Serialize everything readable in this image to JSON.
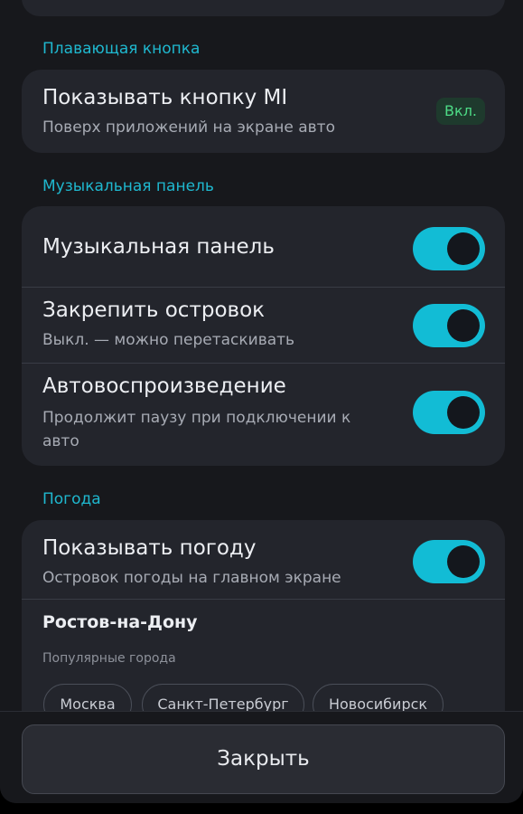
{
  "floating": {
    "section_title": "Плавающая кнопка",
    "title": "Показывать кнопку MI",
    "subtitle": "Поверх приложений на экране авто",
    "badge": "Вкл."
  },
  "music": {
    "section_title": "Музыкальная панель",
    "rows": [
      {
        "title": "Музыкальная панель",
        "subtitle": "",
        "enabled": true
      },
      {
        "title": "Закрепить островок",
        "subtitle": "Выкл. — можно перетаскивать",
        "enabled": true
      },
      {
        "title": "Автовоспроизведение",
        "subtitle": "Продолжит паузу при подключении к авто",
        "enabled": true
      }
    ]
  },
  "weather": {
    "section_title": "Погода",
    "title": "Показывать погоду",
    "subtitle": "Островок погоды на главном экране",
    "enabled": true,
    "city": "Ростов-на-Дону",
    "popular_label": "Популярные города",
    "popular_cities": [
      "Москва",
      "Санкт-Петербург",
      "Новосибирск"
    ]
  },
  "footer": {
    "close_label": "Закрыть"
  },
  "colors": {
    "accent": "#12bcd5",
    "badge_text": "#4ddb86",
    "card": "#23252c",
    "background": "#17181c"
  }
}
